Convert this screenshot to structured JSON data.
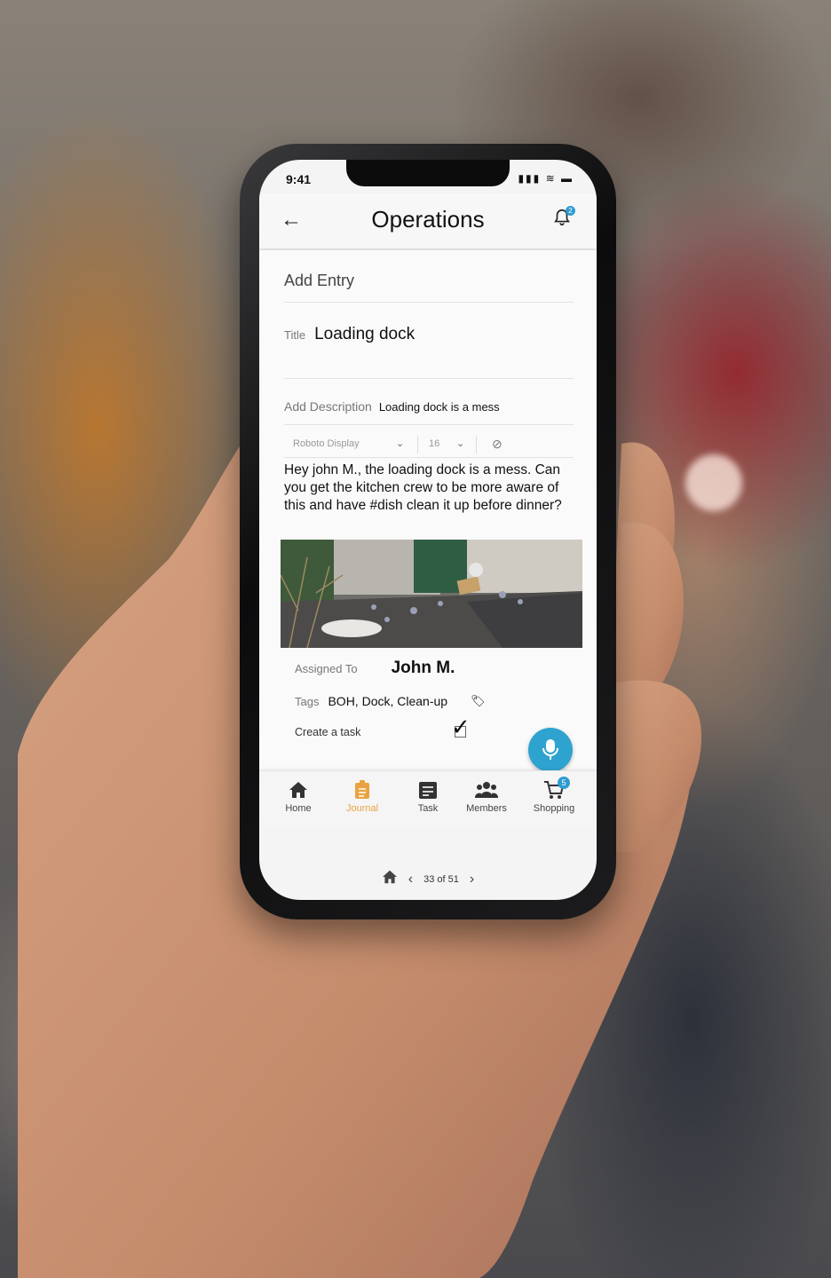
{
  "status_bar": {
    "time": "9:41"
  },
  "header": {
    "title": "Operations",
    "notification_count": "2"
  },
  "form": {
    "section_title": "Add Entry",
    "title_label": "Title",
    "title_value": "Loading dock",
    "description_label": "Add Description",
    "description_value": "Loading dock is a mess",
    "toolbar": {
      "font": "Roboto Display",
      "size": "16"
    },
    "body": "Hey john M., the loading dock is a mess. Can you get the kitchen crew to be more aware of this and have #dish clean it up before dinner?",
    "assigned_label": "Assigned To",
    "assigned_value": "John M.",
    "tags_label": "Tags",
    "tags_value": "BOH, Dock, Clean-up",
    "task_label": "Create a task",
    "task_checked": true
  },
  "tabs": [
    {
      "label": "Home",
      "icon": "home-icon"
    },
    {
      "label": "Journal",
      "icon": "journal-icon",
      "active": true
    },
    {
      "label": "Task",
      "icon": "task-icon"
    },
    {
      "label": "Members",
      "icon": "members-icon"
    },
    {
      "label": "Shopping",
      "icon": "cart-icon",
      "badge": "5"
    }
  ],
  "pager": {
    "text": "33 of 51"
  },
  "colors": {
    "accent": "#e8a340",
    "blue": "#2ea3cf"
  }
}
